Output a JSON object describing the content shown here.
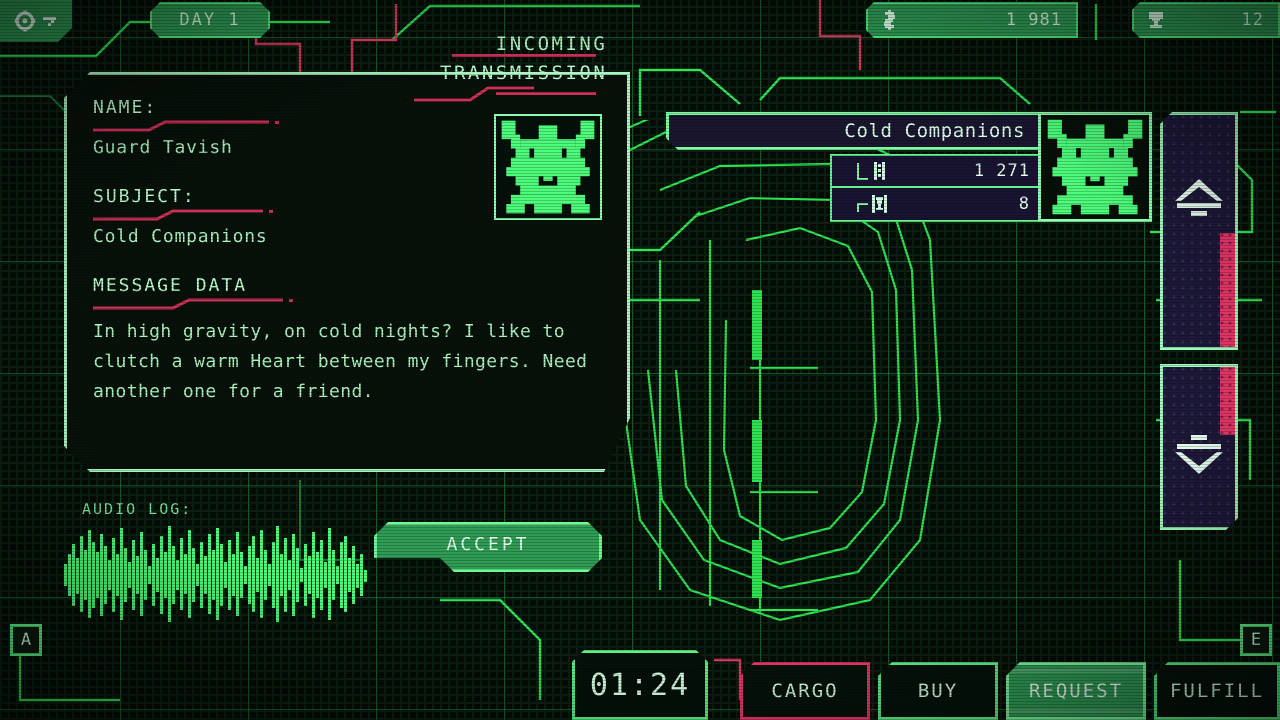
{
  "topbar": {
    "settings_icon": "gear-icon",
    "day_label": "DAY 1",
    "credits": {
      "icon": "credits-icon",
      "value": "1 981"
    },
    "tokens": {
      "icon": "trophy-icon",
      "value": "12"
    }
  },
  "transmission": {
    "header_line1": "INCOMING",
    "header_line2": "TRANSMISSION",
    "name_label": "NAME:",
    "name_value": "Guard Tavish",
    "subject_label": "SUBJECT:",
    "subject_value": "Cold Companions",
    "message_label": "MESSAGE DATA",
    "message_body": "In high gravity, on cold nights? I like to clutch a warm Heart between my fingers. Need another one for a friend.",
    "accept_label": "ACCEPT",
    "portrait_icon": "oni-face-portrait"
  },
  "audio_log": {
    "label": "AUDIO LOG:",
    "waveform_icon": "waveform-icon"
  },
  "request_card": {
    "title": "Cold Companions",
    "rewards": [
      {
        "icon": "credits-icon",
        "value": "1 271"
      },
      {
        "icon": "trophy-icon",
        "value": "8"
      }
    ],
    "portrait_icon": "oni-face-portrait"
  },
  "scroll": {
    "up_icon": "scroll-up-icon",
    "down_icon": "scroll-down-icon"
  },
  "key_hints": {
    "left": "A",
    "right": "E"
  },
  "bottombar": {
    "clock": "01:24",
    "buttons": [
      {
        "label": "CARGO",
        "state": "pink"
      },
      {
        "label": "BUY",
        "state": "normal"
      },
      {
        "label": "REQUEST",
        "state": "active"
      },
      {
        "label": "FULFILL",
        "state": "normal"
      }
    ]
  },
  "colors": {
    "accent_green": "#4dfc7b",
    "panel_green": "#2f9c55",
    "accent_pink": "#e8376b",
    "text_green": "#a9f3bf",
    "bg_dark": "#040b06",
    "panel_purple": "#1d1838"
  }
}
